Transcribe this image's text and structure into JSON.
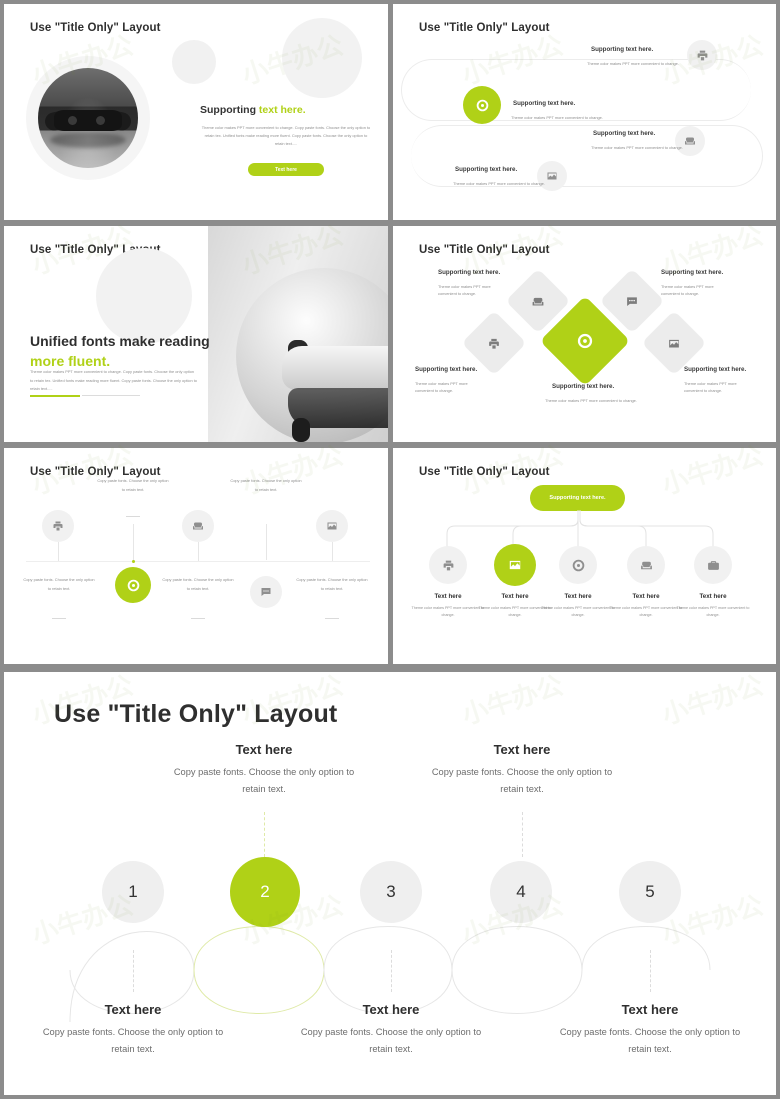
{
  "common": {
    "slide_title": "Use \"Title Only\" Layout",
    "supporting_heading": "Supporting text here.",
    "supporting_body": "Theme color makes PPT more convenient to change.",
    "copy_paste_body": "Copy paste fonts. Choose the only option to retain text.",
    "text_here": "Text here",
    "accent_color": "#b0d117",
    "neutral_color": "#efefef",
    "text_color": "#2f2f2f"
  },
  "slide1": {
    "title": "Use \"Title Only\" Layout",
    "heading_dark": "Supporting",
    "heading_accent": "text here.",
    "body": "Theme color makes PPT more convenient to change. Copy paste fonts. Choose the only option to retain tex. Unified fonts make reading more fluent. Copy paste fonts. Choose the only option to retain text.....",
    "button_label": "Text here",
    "photo_alt": "game-controller-photo"
  },
  "slide2": {
    "title": "Use \"Title Only\" Layout",
    "items": [
      {
        "heading": "Supporting text here.",
        "body": "Theme color makes PPT more convenient to change.",
        "icon": "printer-icon",
        "highlight": false
      },
      {
        "heading": "Supporting text here.",
        "body": "Theme color makes PPT more convenient to change.",
        "icon": "record-icon",
        "highlight": true
      },
      {
        "heading": "Supporting text here.",
        "body": "Theme color makes PPT more convenient to change.",
        "icon": "sofa-icon",
        "highlight": false
      },
      {
        "heading": "Supporting text here.",
        "body": "Theme color makes PPT more convenient to change.",
        "icon": "image-icon",
        "highlight": false
      }
    ]
  },
  "slide3": {
    "title": "Use \"Title Only\" Layout",
    "heading_line1": "Unified fonts make reading",
    "heading_line2": "more fluent.",
    "body": "Theme color makes PPT more convenient to change. Copy paste fonts. Choose the only option to retain tex. Unified fonts make reading more fluent. Copy paste fonts. Choose the only option to retain text.....",
    "photo_alt": "game-controller-photo"
  },
  "slide4": {
    "title": "Use \"Title Only\" Layout",
    "items": [
      {
        "heading": "Supporting text here.",
        "body": "Theme color makes PPT more convenient to change.",
        "icon": "sofa-icon",
        "highlight": false,
        "pos": "top-left"
      },
      {
        "heading": "Supporting text here.",
        "body": "Theme color makes PPT more convenient to change.",
        "icon": "chat-icon",
        "highlight": false,
        "pos": "top-right"
      },
      {
        "heading": "Supporting text here.",
        "body": "Theme color makes PPT more convenient to change.",
        "icon": "printer-icon",
        "highlight": false,
        "pos": "left"
      },
      {
        "heading": "Supporting text here.",
        "body": "Theme color makes PPT more convenient to change.",
        "icon": "image-icon",
        "highlight": false,
        "pos": "right"
      },
      {
        "heading": "Supporting text here.",
        "body": "Theme color makes PPT more convenient to change.",
        "icon": "record-icon",
        "highlight": true,
        "pos": "center"
      }
    ]
  },
  "slide5": {
    "title": "Use \"Title Only\" Layout",
    "items": [
      {
        "body": "Copy paste fonts. Choose the only option to retain text.",
        "icon": "printer-icon",
        "highlight": false,
        "side": "below"
      },
      {
        "body": "Copy paste fonts. Choose the only option to retain text.",
        "icon": "record-icon",
        "highlight": true,
        "side": "above"
      },
      {
        "body": "Copy paste fonts. Choose the only option to retain text.",
        "icon": "sofa-icon",
        "highlight": false,
        "side": "below"
      },
      {
        "body": "Copy paste fonts. Choose the only option to retain text.",
        "icon": "chat-icon",
        "highlight": false,
        "side": "above"
      },
      {
        "body": "Copy paste fonts. Choose the only option to retain text.",
        "icon": "image-icon",
        "highlight": false,
        "side": "below"
      }
    ]
  },
  "slide6": {
    "title": "Use \"Title Only\" Layout",
    "root_label": "Supporting text here.",
    "items": [
      {
        "label": "Text here",
        "body": "Theme color makes PPT more convenient to change.",
        "icon": "printer-icon",
        "highlight": false
      },
      {
        "label": "Text here",
        "body": "Theme color makes PPT more convenient to change.",
        "icon": "image-icon",
        "highlight": true
      },
      {
        "label": "Text here",
        "body": "Theme color makes PPT more convenient to change.",
        "icon": "record-icon",
        "highlight": false
      },
      {
        "label": "Text here",
        "body": "Theme color makes PPT more convenient to change.",
        "icon": "sofa-icon",
        "highlight": false
      },
      {
        "label": "Text here",
        "body": "Theme color makes PPT more convenient to change.",
        "icon": "briefcase-icon",
        "highlight": false
      }
    ]
  },
  "big_slide": {
    "title": "Use \"Title Only\" Layout",
    "steps": [
      {
        "number": "1",
        "label": "Text here",
        "body": "Copy paste fonts. Choose the only option to retain text.",
        "highlight": false,
        "side": "below"
      },
      {
        "number": "2",
        "label": "Text here",
        "body": "Copy paste fonts. Choose the only option to retain text.",
        "highlight": true,
        "side": "above"
      },
      {
        "number": "3",
        "label": "Text here",
        "body": "Copy paste fonts. Choose the only option to retain text.",
        "highlight": false,
        "side": "below"
      },
      {
        "number": "4",
        "label": "Text here",
        "body": "Copy paste fonts. Choose the only option to retain text.",
        "highlight": false,
        "side": "above"
      },
      {
        "number": "5",
        "label": "Text here",
        "body": "Copy paste fonts. Choose the only option to retain text.",
        "highlight": false,
        "side": "below"
      }
    ]
  },
  "watermark": {
    "text": "小牛办公"
  }
}
